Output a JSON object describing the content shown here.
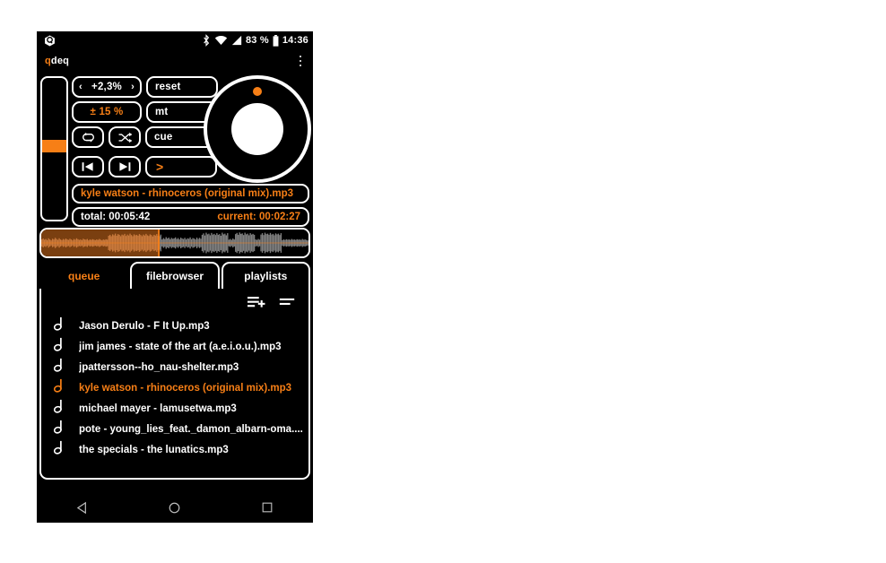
{
  "statusbar": {
    "app_logo_icon": "q-logo-icon",
    "bluetooth_icon": "bluetooth-icon",
    "wifi_icon": "wifi-icon",
    "signal_icon": "cell-signal-icon",
    "battery_percent": "83 %",
    "battery_icon": "battery-icon",
    "clock": "14:36"
  },
  "appbar": {
    "title_accent": "q",
    "title_rest": "deq",
    "overflow_icon": "overflow-menu-icon"
  },
  "deck": {
    "pitch": {
      "decrement": "‹",
      "value": "+2,3%",
      "increment": "›"
    },
    "range_label": "± 15 %",
    "loop_icon": "loop-icon",
    "shuffle_icon": "shuffle-icon",
    "reset_label": "reset",
    "mt_label": "mt",
    "cue_label": "cue",
    "prev_icon": "skip-previous-icon",
    "next_icon": "skip-next-icon",
    "play_label": ">",
    "jog_wheel_icon": "jog-wheel",
    "jog_marker_icon": "jog-position-dot",
    "fader_name": "pitch-fader",
    "track_title": "kyle watson - rhinoceros (original mix).mp3",
    "time_total": "total: 00:05:42",
    "time_current": "current: 00:02:27"
  },
  "waveform": {
    "name": "waveform-display",
    "progress_percent": 44,
    "played_bg": "#7a3f10",
    "played_wave": "#c9793c",
    "unplayed_bg": "#000000",
    "unplayed_wave": "#808080",
    "playhead_color": "#f77f16",
    "amplitudes": [
      0.3,
      0.38,
      0.28,
      0.34,
      0.24,
      0.4,
      0.3,
      0.22,
      0.36,
      0.3,
      0.44,
      0.34,
      0.26,
      0.4,
      0.3,
      0.24,
      0.34,
      0.28,
      0.38,
      0.3,
      0.26,
      0.36,
      0.3,
      0.22,
      0.34,
      0.28,
      0.4,
      0.32,
      0.26,
      0.3,
      0.24,
      0.36,
      0.3,
      0.28,
      0.34,
      0.22,
      0.3,
      0.26,
      0.32,
      0.28,
      0.24,
      0.3,
      0.26,
      0.34,
      0.28,
      0.22,
      0.3,
      0.26,
      0.32,
      0.28,
      0.62,
      0.7,
      0.58,
      0.74,
      0.66,
      0.8,
      0.62,
      0.76,
      0.7,
      0.58,
      0.72,
      0.66,
      0.78,
      0.6,
      0.72,
      0.64,
      0.8,
      0.68,
      0.58,
      0.74,
      0.66,
      0.7,
      0.62,
      0.76,
      0.68,
      0.58,
      0.72,
      0.64,
      0.78,
      0.66,
      0.6,
      0.74,
      0.68,
      0.56,
      0.7,
      0.64,
      0.76,
      0.62,
      0.58,
      0.72,
      0.3,
      0.42,
      0.34,
      0.5,
      0.38,
      0.46,
      0.32,
      0.44,
      0.36,
      0.4,
      0.48,
      0.34,
      0.42,
      0.3,
      0.46,
      0.38,
      0.34,
      0.44,
      0.3,
      0.4,
      0.36,
      0.48,
      0.32,
      0.42,
      0.38,
      0.3,
      0.46,
      0.34,
      0.44,
      0.36,
      0.7,
      0.82,
      0.64,
      0.88,
      0.74,
      0.8,
      0.66,
      0.86,
      0.72,
      0.78,
      0.68,
      0.84,
      0.7,
      0.76,
      0.62,
      0.88,
      0.74,
      0.8,
      0.66,
      0.84,
      0.28,
      0.34,
      0.26,
      0.38,
      0.3,
      0.76,
      0.86,
      0.7,
      0.9,
      0.78,
      0.82,
      0.68,
      0.88,
      0.74,
      0.8,
      0.66,
      0.84,
      0.72,
      0.78,
      0.7,
      0.3,
      0.26,
      0.34,
      0.28,
      0.72,
      0.84,
      0.68,
      0.88,
      0.76,
      0.8,
      0.7,
      0.86,
      0.72,
      0.78,
      0.66,
      0.82,
      0.74,
      0.8,
      0.68,
      0.84,
      0.24,
      0.3,
      0.26,
      0.32,
      0.28,
      0.3,
      0.26,
      0.34,
      0.28,
      0.3,
      0.26,
      0.32,
      0.28,
      0.3,
      0.26,
      0.34,
      0.28,
      0.3,
      0.26,
      0.22
    ]
  },
  "tabs": [
    {
      "label": "queue",
      "active": true
    },
    {
      "label": "filebrowser",
      "active": false
    },
    {
      "label": "playlists",
      "active": false
    }
  ],
  "list_actions": [
    {
      "name": "add-to-playlist-icon",
      "label": "add-to-playlist"
    },
    {
      "name": "sort-list-icon",
      "label": "sort-list"
    }
  ],
  "tracks": [
    {
      "name": "Jason Derulo - F It Up.mp3",
      "current": false
    },
    {
      "name": "jim james - state of the art (a.e.i.o.u.).mp3",
      "current": false
    },
    {
      "name": "jpattersson--ho_nau-shelter.mp3",
      "current": false
    },
    {
      "name": "kyle watson - rhinoceros (original mix).mp3",
      "current": true
    },
    {
      "name": "michael mayer - lamusetwa.mp3",
      "current": false
    },
    {
      "name": "pote - young_lies_feat._damon_albarn-oma....",
      "current": false
    },
    {
      "name": "the specials - the lunatics.mp3",
      "current": false
    }
  ],
  "navbar": {
    "back_icon": "back-triangle-icon",
    "home_icon": "home-circle-icon",
    "recents_icon": "recents-square-icon"
  },
  "colors": {
    "accent": "#f77f16",
    "background": "#000000",
    "foreground": "#ffffff"
  }
}
